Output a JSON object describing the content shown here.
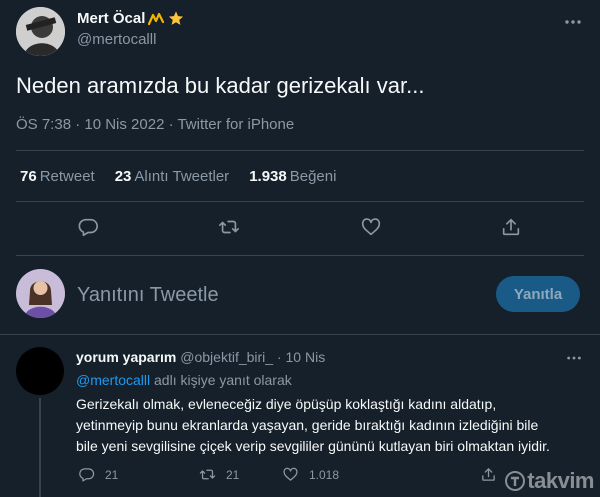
{
  "main_tweet": {
    "author_name": "Mert Öcal",
    "author_handle": "@mertocalll",
    "badge_icons": [
      "wave-emoji-icon",
      "star-emoji-icon"
    ],
    "text": "Neden aramızda bu kadar gerizekalı var...",
    "meta": "ÖS 7:38 · 10 Nis 2022 · Twitter for iPhone",
    "stats": [
      {
        "count": "76",
        "label": "Retweet"
      },
      {
        "count": "23",
        "label": "Alıntı Tweetler"
      },
      {
        "count": "1.938",
        "label": "Beğeni"
      }
    ],
    "actions": [
      "reply-icon",
      "retweet-icon",
      "like-icon",
      "share-icon"
    ]
  },
  "compose": {
    "placeholder": "Yanıtını Tweetle",
    "button_label": "Yanıtla"
  },
  "reply_tweet": {
    "author_name": "yorum yaparım",
    "author_handle": "@objektif_biri_",
    "date": "· 10 Nis",
    "replying_to_handle": "@mertocalll",
    "replying_to_text": "adlı kişiye yanıt olarak",
    "lines": [
      "Gerizekalı olmak, evleneceğiz diye öpüşüp koklaştığı kadını aldatıp,",
      "yetinmeyip bunu ekranlarda yaşayan, geride bıraktığı kadının izlediğini bile",
      "bile yeni sevgilisine çiçek verip sevgililer gününü kutlayan biri olmaktan iyidir."
    ],
    "reply_count": "21",
    "retweet_count": "21",
    "like_count": "1.018"
  },
  "watermark": "takvim"
}
